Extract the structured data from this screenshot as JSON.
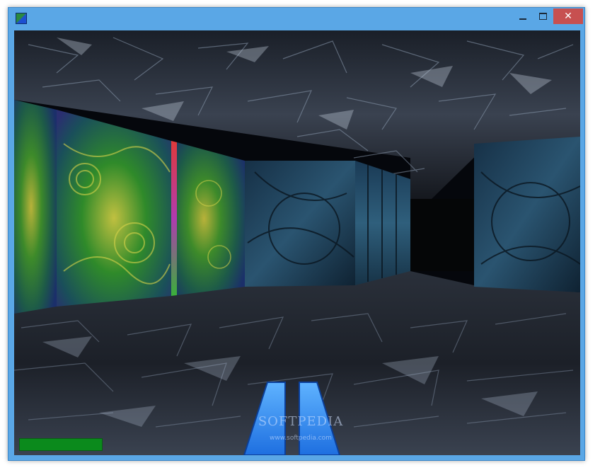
{
  "window": {
    "icon": "app-icon",
    "controls": {
      "minimize_icon": "minimize-icon",
      "maximize_icon": "maximize-icon",
      "close_icon": "close-icon",
      "close_glyph": "✕"
    },
    "close_color": "#c75050",
    "frame_color": "#5aa7e6"
  },
  "hud": {
    "health_fraction": 1.0,
    "health_color": "#0b8a1c"
  },
  "watermark": {
    "text": "SOFTPEDIA",
    "url": "www.softpedia.com"
  },
  "scene": {
    "weapon_color": "#2f8fff",
    "floor_color": "#2e3440",
    "ceiling_color": "#2b323e",
    "fractal_wall_color": "#3f7d2a",
    "blue_wall_color": "#1d3a52"
  }
}
